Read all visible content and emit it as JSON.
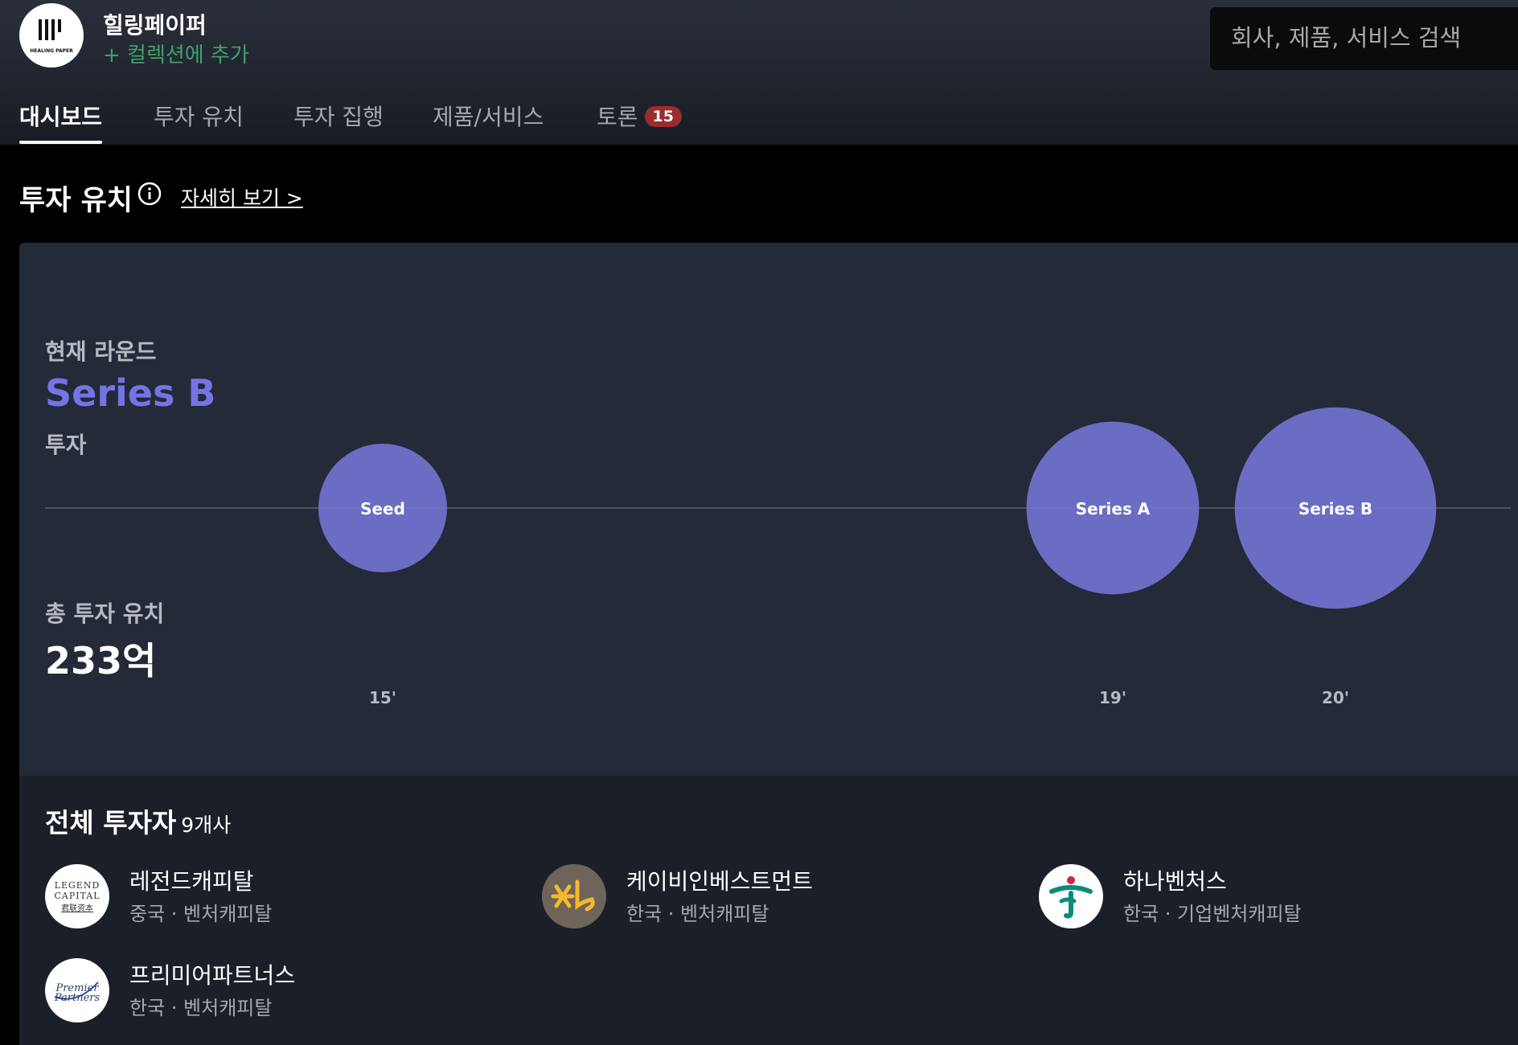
{
  "company": {
    "name": "힐링페이퍼",
    "add_collection": "+ 컬렉션에 추가",
    "logo_text": "HEALING PAPER"
  },
  "search": {
    "placeholder": "회사, 제품, 서비스 검색"
  },
  "tabs": [
    {
      "label": "대시보드",
      "active": true
    },
    {
      "label": "투자 유치"
    },
    {
      "label": "투자 집행"
    },
    {
      "label": "제품/서비스"
    },
    {
      "label": "토론",
      "badge": "15"
    }
  ],
  "section": {
    "title": "투자 유치",
    "more_link": "자세히 보기 >"
  },
  "summary": {
    "round_label": "현재 라운드",
    "round_value": "Series B",
    "round_type": "투자",
    "total_label": "총 투자 유치",
    "total_value": "233억"
  },
  "chart_data": {
    "type": "scatter",
    "points": [
      {
        "label": "Seed",
        "year": "15'",
        "size": 1
      },
      {
        "label": "Series A",
        "year": "19'",
        "size": 1.8
      },
      {
        "label": "Series B",
        "year": "20'",
        "size": 2.45
      }
    ]
  },
  "investors": {
    "title": "전체 투자자",
    "count": "9개사",
    "items": [
      {
        "name": "레전드캐피탈",
        "meta": "중국 · 벤처캐피탈",
        "logo": "legend-capital-logo"
      },
      {
        "name": "케이비인베스트먼트",
        "meta": "한국 · 벤처캐피탈",
        "logo": "kb-logo"
      },
      {
        "name": "하나벤처스",
        "meta": "한국 · 기업벤처캐피탈",
        "logo": "hana-logo"
      },
      {
        "name": "프리미어파트너스",
        "meta": "한국 · 벤처캐피탈",
        "logo": "premier-partners-logo"
      }
    ],
    "logo_texts": {
      "legend": [
        "LEGEND",
        "CAPITAL",
        "君联资本"
      ],
      "premier": [
        "Premier",
        "Partners"
      ]
    }
  },
  "colors": {
    "accent": "#7474e6",
    "bubble": "#7173cf",
    "link_green": "#3fa16b",
    "badge": "#9a2c2c"
  }
}
